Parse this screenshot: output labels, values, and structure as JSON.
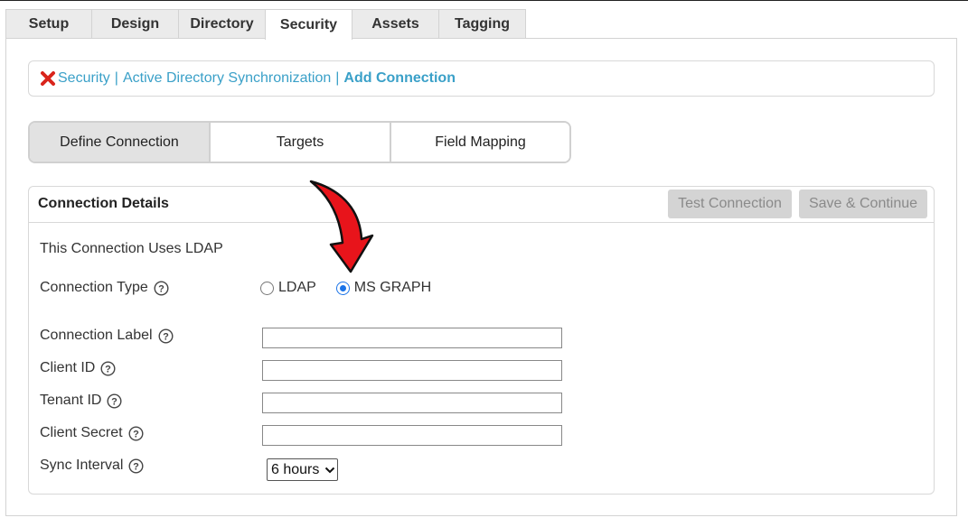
{
  "tabs": [
    {
      "label": "Setup",
      "active": false
    },
    {
      "label": "Design",
      "active": false
    },
    {
      "label": "Directory",
      "active": false
    },
    {
      "label": "Security",
      "active": true
    },
    {
      "label": "Assets",
      "active": false
    },
    {
      "label": "Tagging",
      "active": false
    }
  ],
  "breadcrumb": {
    "items": [
      "Security",
      "Active Directory Synchronization"
    ],
    "separator": "|",
    "current": "Add Connection",
    "icon": "close-x-icon"
  },
  "steps": [
    {
      "label": "Define Connection",
      "active": true
    },
    {
      "label": "Targets",
      "active": false
    },
    {
      "label": "Field Mapping",
      "active": false
    }
  ],
  "details": {
    "title": "Connection Details",
    "test_button": "Test Connection",
    "save_button": "Save & Continue",
    "info_text": "This Connection Uses LDAP",
    "connection_type": {
      "label": "Connection Type",
      "options": [
        {
          "label": "LDAP",
          "checked": false
        },
        {
          "label": "MS GRAPH",
          "checked": true
        }
      ]
    },
    "fields": {
      "connection_label": {
        "label": "Connection Label",
        "value": ""
      },
      "client_id": {
        "label": "Client ID",
        "value": ""
      },
      "tenant_id": {
        "label": "Tenant ID",
        "value": ""
      },
      "client_secret": {
        "label": "Client Secret",
        "value": ""
      }
    },
    "sync_interval": {
      "label": "Sync Interval",
      "value": "6 hours"
    }
  },
  "colors": {
    "link": "#3aa0c8",
    "accent_radio": "#1a73e8",
    "annotation_arrow": "#e8141b",
    "disabled_button_bg": "#d4d4d4"
  }
}
